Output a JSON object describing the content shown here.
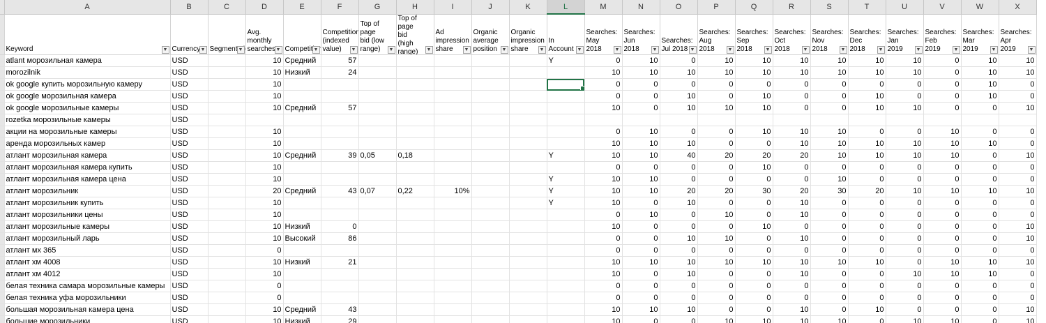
{
  "columns": [
    "A",
    "B",
    "C",
    "D",
    "E",
    "F",
    "G",
    "H",
    "I",
    "J",
    "K",
    "L",
    "M",
    "N",
    "O",
    "P",
    "Q",
    "R",
    "S",
    "T",
    "U",
    "V",
    "W",
    "X"
  ],
  "selected_column": "L",
  "headers": [
    "Keyword",
    "Currency",
    "Segmentation",
    "Avg. monthly searches",
    "Competition",
    "Competition (indexed value)",
    "Top of page bid (low range)",
    "Top of page bid (high range)",
    "Ad impression share",
    "Organic average position",
    "Organic impression share",
    "In Account",
    "Searches: May 2018",
    "Searches: Jun 2018",
    "Searches: Jul 2018",
    "Searches: Aug 2018",
    "Searches: Sep 2018",
    "Searches: Oct 2018",
    "Searches: Nov 2018",
    "Searches: Dec 2018",
    "Searches: Jan 2019",
    "Searches: Feb 2019",
    "Searches: Mar 2019",
    "Searches: Apr 2019"
  ],
  "active_cell": {
    "row": 2,
    "col": 11
  },
  "rows": [
    [
      "atlant морозильная камера",
      "USD",
      "",
      "10",
      "Средний",
      "57",
      "",
      "",
      "",
      "",
      "",
      "Y",
      "0",
      "10",
      "0",
      "10",
      "10",
      "10",
      "10",
      "10",
      "10",
      "0",
      "10",
      "10"
    ],
    [
      "morozilnik",
      "USD",
      "",
      "10",
      "Низкий",
      "24",
      "",
      "",
      "",
      "",
      "",
      "",
      "10",
      "10",
      "10",
      "10",
      "10",
      "10",
      "10",
      "10",
      "10",
      "0",
      "10",
      "10"
    ],
    [
      "ok google купить морозильную камеру",
      "USD",
      "",
      "10",
      "",
      "",
      "",
      "",
      "",
      "",
      "",
      "",
      "0",
      "0",
      "0",
      "0",
      "0",
      "0",
      "0",
      "0",
      "0",
      "0",
      "10",
      "0"
    ],
    [
      "ok google морозильная камера",
      "USD",
      "",
      "10",
      "",
      "",
      "",
      "",
      "",
      "",
      "",
      "",
      "0",
      "0",
      "10",
      "0",
      "10",
      "0",
      "0",
      "10",
      "0",
      "0",
      "10",
      "0"
    ],
    [
      "ok google морозильные камеры",
      "USD",
      "",
      "10",
      "Средний",
      "57",
      "",
      "",
      "",
      "",
      "",
      "",
      "10",
      "0",
      "10",
      "10",
      "10",
      "0",
      "0",
      "10",
      "10",
      "0",
      "0",
      "10"
    ],
    [
      "rozetka морозильные камеры",
      "USD",
      "",
      "",
      "",
      "",
      "",
      "",
      "",
      "",
      "",
      "",
      "",
      "",
      "",
      "",
      "",
      "",
      "",
      "",
      "",
      "",
      "",
      ""
    ],
    [
      "акции на морозильные камеры",
      "USD",
      "",
      "10",
      "",
      "",
      "",
      "",
      "",
      "",
      "",
      "",
      "0",
      "10",
      "0",
      "0",
      "10",
      "10",
      "10",
      "0",
      "0",
      "10",
      "0",
      "0"
    ],
    [
      "аренда морозильных камер",
      "USD",
      "",
      "10",
      "",
      "",
      "",
      "",
      "",
      "",
      "",
      "",
      "10",
      "10",
      "10",
      "0",
      "0",
      "10",
      "10",
      "10",
      "10",
      "10",
      "10",
      "0"
    ],
    [
      "атлант морозильная камера",
      "USD",
      "",
      "10",
      "Средний",
      "39",
      "0,05",
      "0,18",
      "",
      "",
      "",
      "Y",
      "10",
      "10",
      "40",
      "20",
      "20",
      "20",
      "10",
      "10",
      "10",
      "10",
      "0",
      "10"
    ],
    [
      "атлант морозильная камера купить",
      "USD",
      "",
      "10",
      "",
      "",
      "",
      "",
      "",
      "",
      "",
      "",
      "0",
      "0",
      "0",
      "0",
      "10",
      "0",
      "0",
      "0",
      "0",
      "0",
      "0",
      "0"
    ],
    [
      "атлант морозильная камера цена",
      "USD",
      "",
      "10",
      "",
      "",
      "",
      "",
      "",
      "",
      "",
      "Y",
      "10",
      "10",
      "0",
      "0",
      "0",
      "0",
      "10",
      "0",
      "0",
      "0",
      "0",
      "0"
    ],
    [
      "атлант морозильник",
      "USD",
      "",
      "20",
      "Средний",
      "43",
      "0,07",
      "0,22",
      "10%",
      "",
      "",
      "Y",
      "10",
      "10",
      "20",
      "20",
      "30",
      "20",
      "30",
      "20",
      "10",
      "10",
      "10",
      "10"
    ],
    [
      "атлант морозильник купить",
      "USD",
      "",
      "10",
      "",
      "",
      "",
      "",
      "",
      "",
      "",
      "Y",
      "10",
      "0",
      "10",
      "0",
      "0",
      "10",
      "0",
      "0",
      "0",
      "0",
      "0",
      "0"
    ],
    [
      "атлант морозильники цены",
      "USD",
      "",
      "10",
      "",
      "",
      "",
      "",
      "",
      "",
      "",
      "",
      "0",
      "10",
      "0",
      "10",
      "0",
      "10",
      "0",
      "0",
      "0",
      "0",
      "0",
      "0"
    ],
    [
      "атлант морозильные камеры",
      "USD",
      "",
      "10",
      "Низкий",
      "0",
      "",
      "",
      "",
      "",
      "",
      "",
      "10",
      "0",
      "0",
      "0",
      "10",
      "0",
      "0",
      "0",
      "0",
      "0",
      "0",
      "10"
    ],
    [
      "атлант морозильный ларь",
      "USD",
      "",
      "10",
      "Высокий",
      "86",
      "",
      "",
      "",
      "",
      "",
      "",
      "0",
      "0",
      "10",
      "10",
      "0",
      "10",
      "0",
      "0",
      "0",
      "0",
      "0",
      "10"
    ],
    [
      "атлант мх 365",
      "USD",
      "",
      "0",
      "",
      "",
      "",
      "",
      "",
      "",
      "",
      "",
      "0",
      "0",
      "0",
      "0",
      "0",
      "0",
      "0",
      "0",
      "0",
      "0",
      "0",
      "0"
    ],
    [
      "атлант хм 4008",
      "USD",
      "",
      "10",
      "Низкий",
      "21",
      "",
      "",
      "",
      "",
      "",
      "",
      "10",
      "10",
      "10",
      "10",
      "10",
      "10",
      "10",
      "10",
      "0",
      "10",
      "10",
      "10"
    ],
    [
      "атлант хм 4012",
      "USD",
      "",
      "10",
      "",
      "",
      "",
      "",
      "",
      "",
      "",
      "",
      "10",
      "0",
      "10",
      "0",
      "0",
      "10",
      "0",
      "0",
      "10",
      "10",
      "10",
      "0"
    ],
    [
      "белая техника самара морозильные камеры",
      "USD",
      "",
      "0",
      "",
      "",
      "",
      "",
      "",
      "",
      "",
      "",
      "0",
      "0",
      "0",
      "0",
      "0",
      "0",
      "0",
      "0",
      "0",
      "0",
      "0",
      "0"
    ],
    [
      "белая техника уфа морозильники",
      "USD",
      "",
      "0",
      "",
      "",
      "",
      "",
      "",
      "",
      "",
      "",
      "0",
      "0",
      "0",
      "0",
      "0",
      "0",
      "0",
      "0",
      "0",
      "0",
      "0",
      "0"
    ],
    [
      "большая морозильная камера цена",
      "USD",
      "",
      "10",
      "Средний",
      "43",
      "",
      "",
      "",
      "",
      "",
      "",
      "10",
      "10",
      "10",
      "0",
      "0",
      "10",
      "0",
      "10",
      "0",
      "0",
      "0",
      "10"
    ],
    [
      "большие морозильники",
      "USD",
      "",
      "10",
      "Низкий",
      "29",
      "",
      "",
      "",
      "",
      "",
      "",
      "10",
      "0",
      "0",
      "10",
      "10",
      "10",
      "10",
      "0",
      "10",
      "10",
      "0",
      "10"
    ]
  ]
}
